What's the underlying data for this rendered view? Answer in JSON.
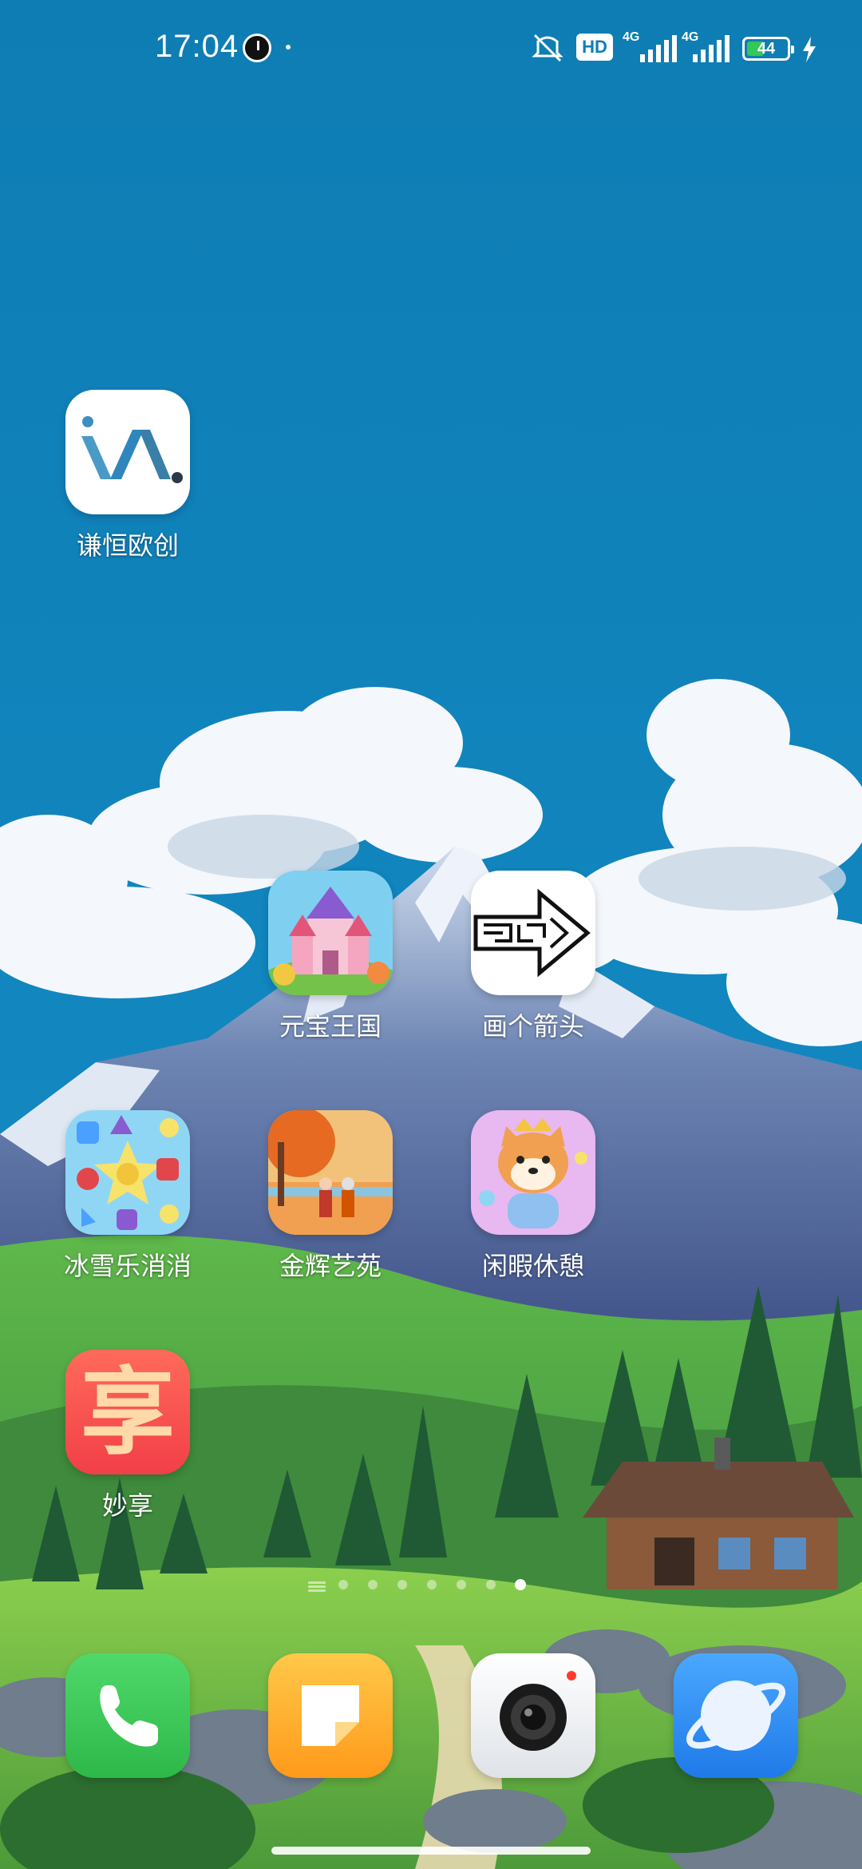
{
  "status_bar": {
    "time": "17:04",
    "network_1": "4G",
    "network_2": "4G",
    "hd_label": "HD",
    "battery_level": "44",
    "battery_percent": 44,
    "charging": true
  },
  "home_apps": [
    {
      "name": "谦恒欧创",
      "icon": "va-logo-icon"
    },
    {
      "name": "元宝王国",
      "icon": "castle-icon"
    },
    {
      "name": "画个箭头",
      "icon": "maze-arrow-icon"
    },
    {
      "name": "冰雪乐消消",
      "icon": "candy-match-icon"
    },
    {
      "name": "金辉艺苑",
      "icon": "autumn-couple-icon"
    },
    {
      "name": "闲暇休憩",
      "icon": "shiba-dog-icon"
    },
    {
      "name": "妙享",
      "icon": "xiang-character-icon"
    }
  ],
  "xiang_glyph": "享",
  "dock": [
    {
      "icon": "phone-icon"
    },
    {
      "icon": "notes-icon"
    },
    {
      "icon": "camera-icon"
    },
    {
      "icon": "browser-icon"
    }
  ],
  "colors": {
    "sky": "#0f7fb6",
    "phone_green": "#34c759",
    "notes_yellow": "#ffb020",
    "browser_blue": "#2f8cf0",
    "xiang_red": "#ff5a4f"
  },
  "page_indicator": {
    "pages": 7,
    "active": 7
  }
}
